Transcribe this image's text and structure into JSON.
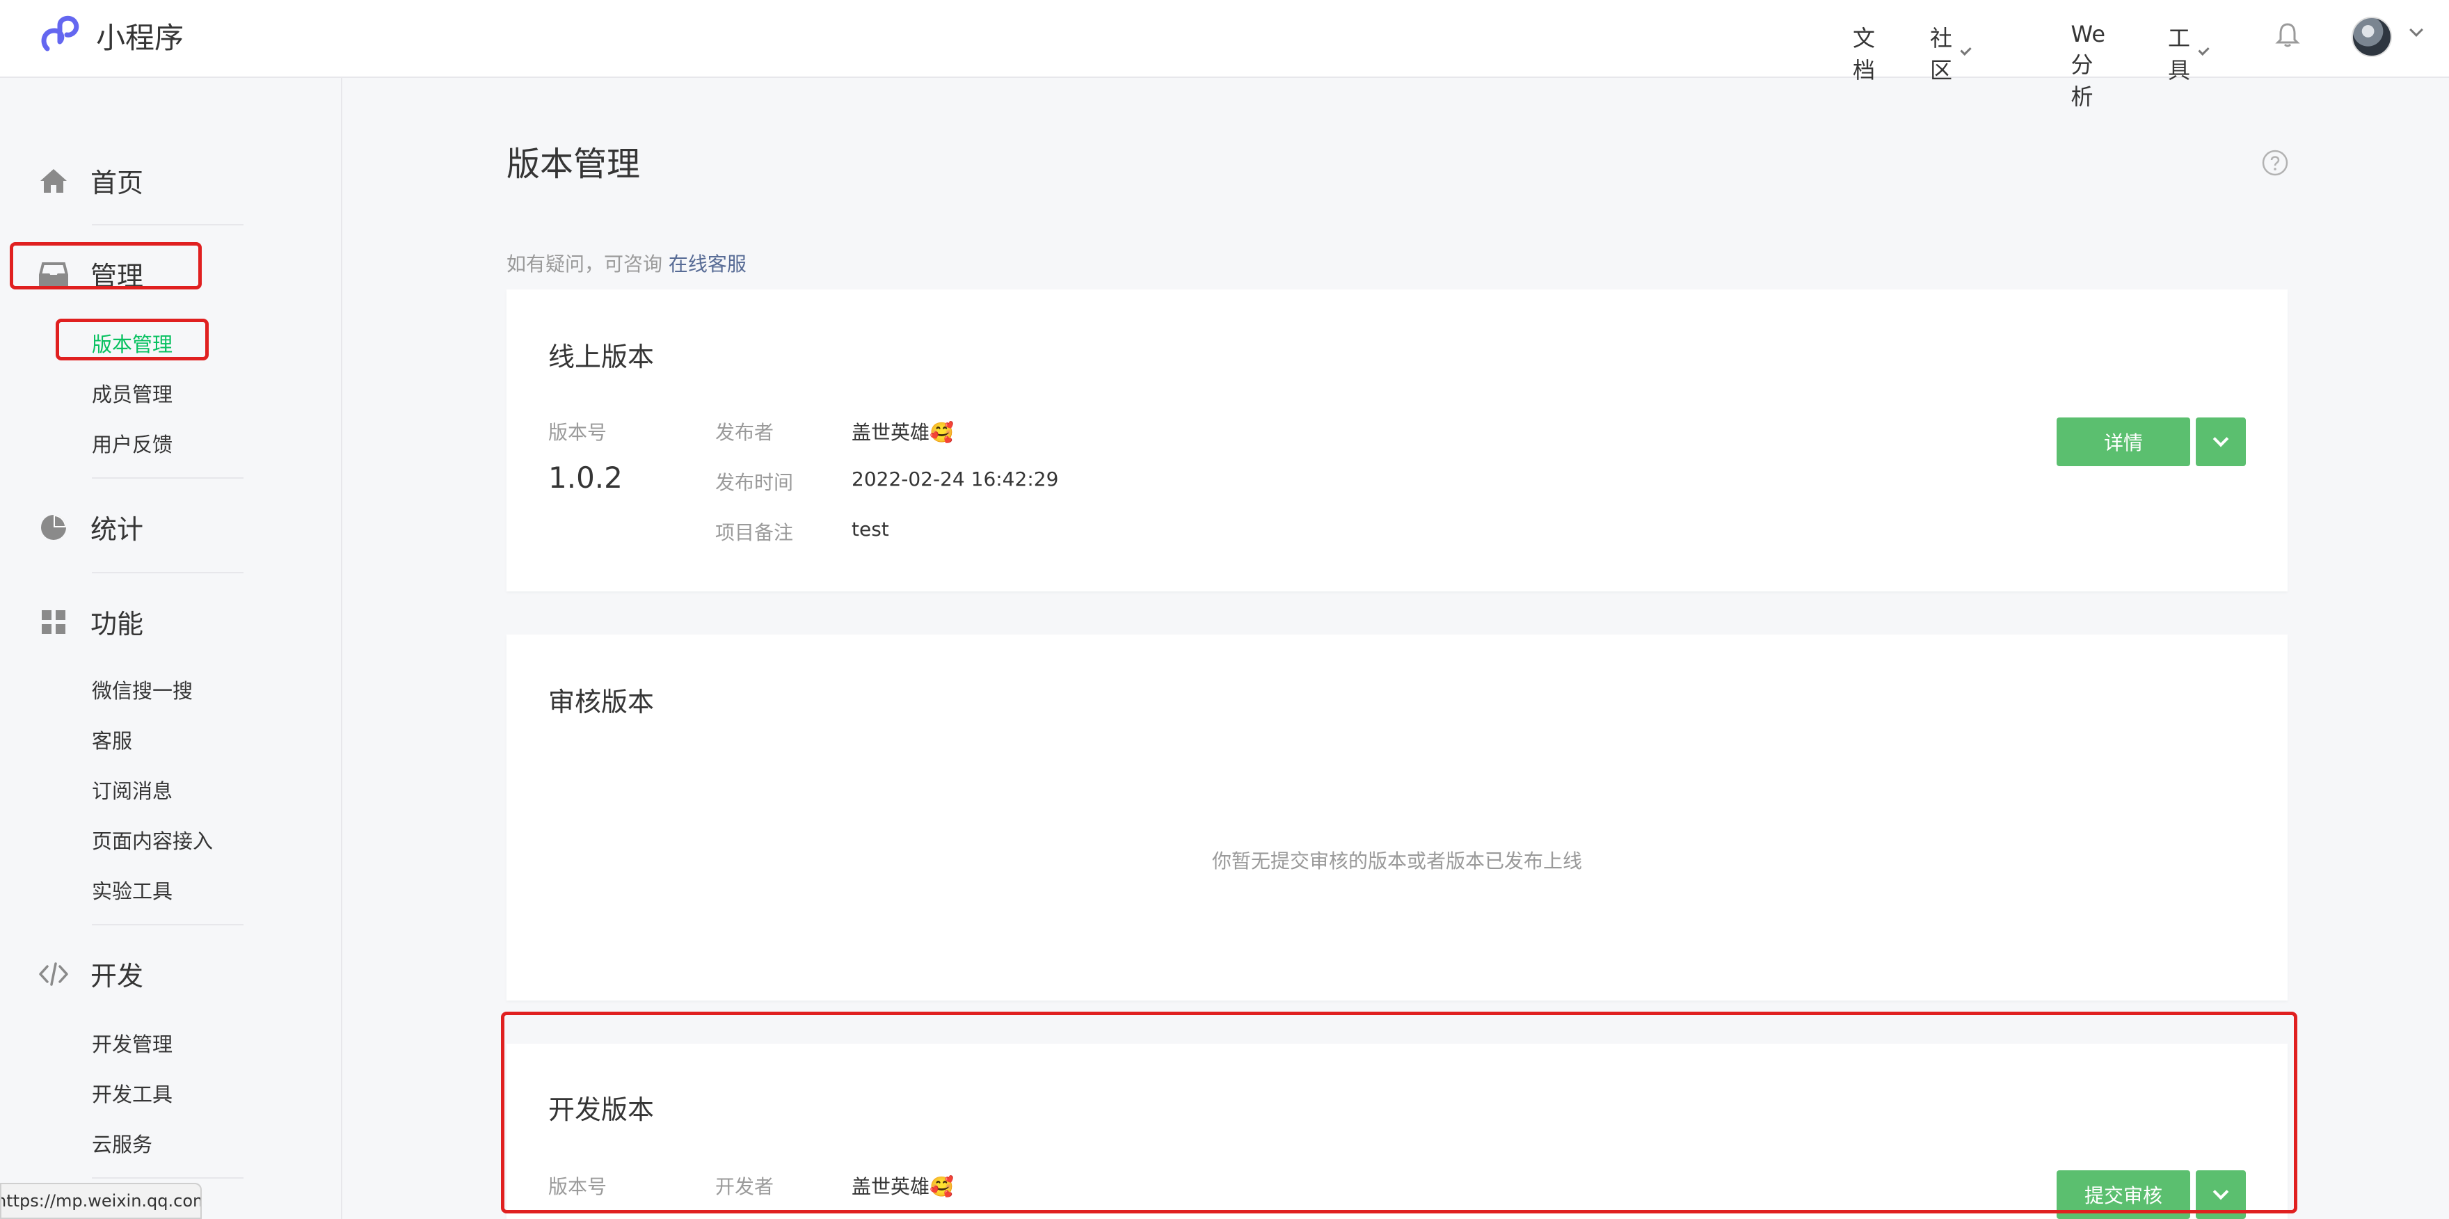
{
  "brand": {
    "name": "小程序"
  },
  "topnav": {
    "docs": "文档",
    "community": "社区",
    "analytics": "We分析",
    "tools": "工具"
  },
  "sidebar": {
    "home": "首页",
    "manage": "管理",
    "manage_items": [
      "版本管理",
      "成员管理",
      "用户反馈"
    ],
    "stats": "统计",
    "features": "功能",
    "feature_items": [
      "微信搜一搜",
      "客服",
      "订阅消息",
      "页面内容接入",
      "实验工具"
    ],
    "develop": "开发",
    "develop_items": [
      "开发管理",
      "开发工具",
      "云服务"
    ]
  },
  "main": {
    "title": "版本管理",
    "tip_prefix": "如有疑问，可咨询",
    "tip_link": "在线客服"
  },
  "online_version": {
    "title": "线上版本",
    "version_label": "版本号",
    "version": "1.0.2",
    "publisher_label": "发布者",
    "publisher": "盖世英雄🥰",
    "time_label": "发布时间",
    "time": "2022-02-24 16:42:29",
    "note_label": "项目备注",
    "note": "test",
    "detail_button": "详情"
  },
  "review_version": {
    "title": "审核版本",
    "empty": "你暂无提交审核的版本或者版本已发布上线"
  },
  "dev_version": {
    "title": "开发版本",
    "version_label": "版本号",
    "developer_label": "开发者",
    "developer": "盖世英雄🥰",
    "submit_button": "提交审核"
  },
  "statusbar": {
    "url": "https://mp.weixin.qq.com"
  },
  "colors": {
    "accent": "#07c160",
    "button": "#5bbf6f",
    "annotation": "#e02020",
    "link": "#576b95"
  }
}
